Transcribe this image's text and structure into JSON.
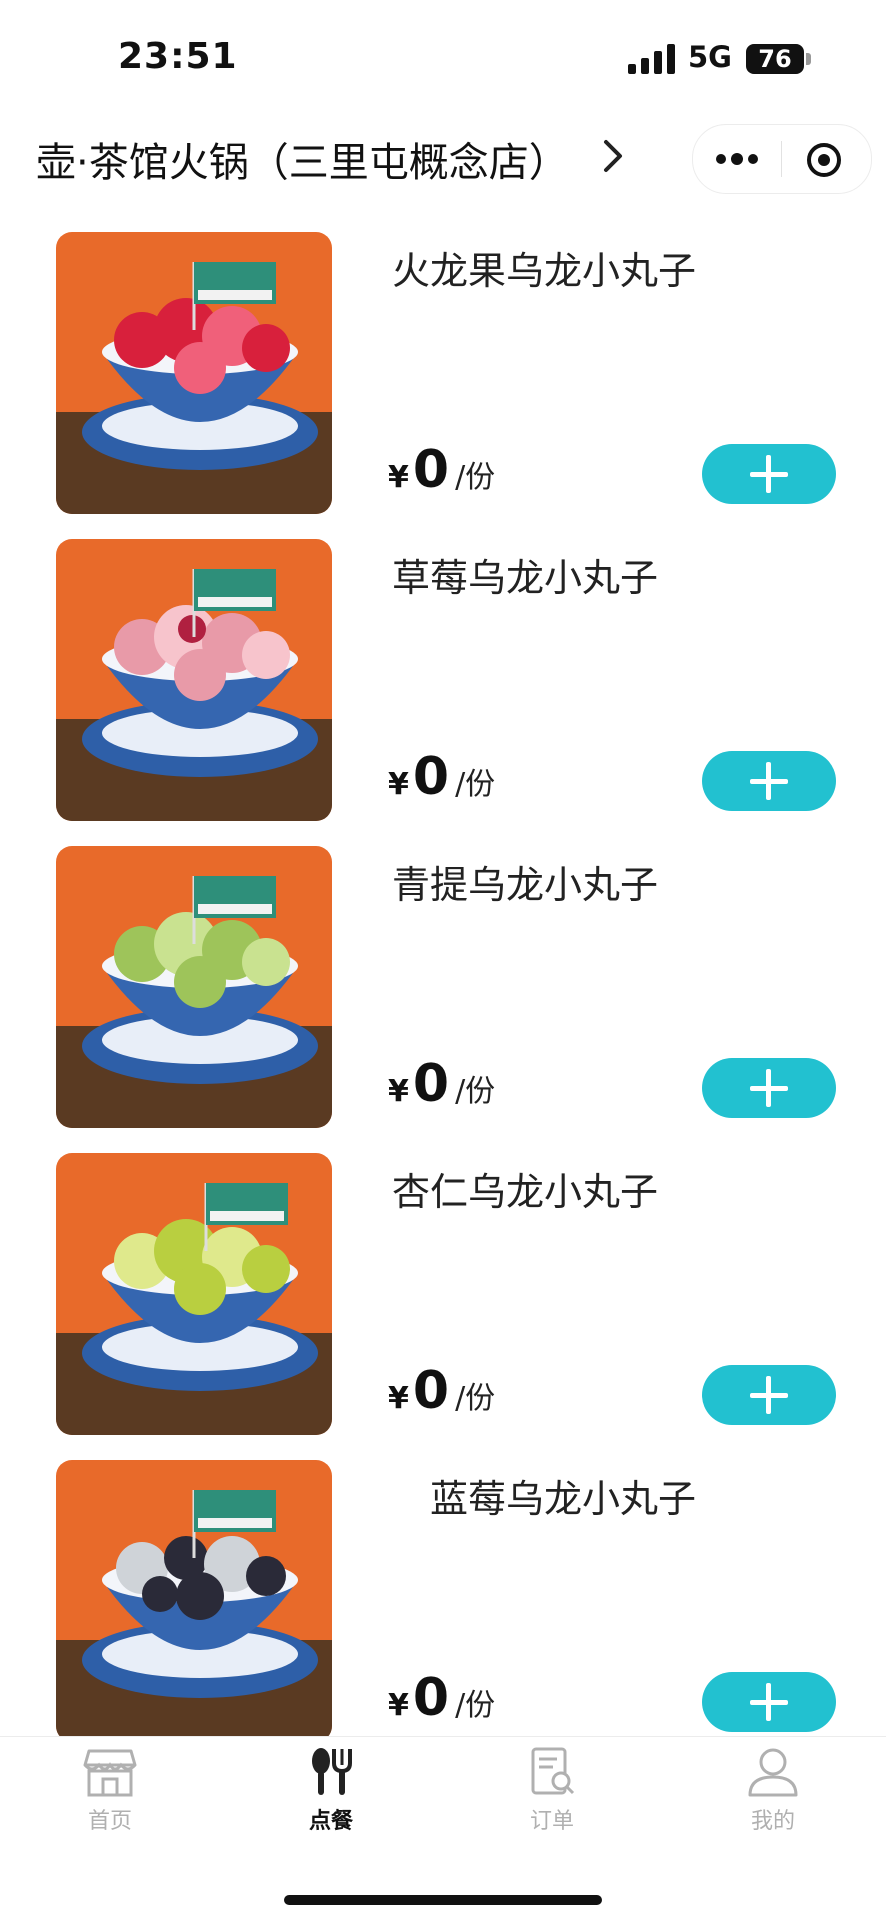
{
  "status_bar": {
    "time": "23:51",
    "network": "5G",
    "battery": "76"
  },
  "nav": {
    "store_title": "壶·茶馆火锅（三里屯概念店）"
  },
  "currency_symbol": "¥",
  "unit_label": "/份",
  "items": [
    {
      "name": "火龙果乌龙小丸子",
      "price": "0",
      "ball_color": "#d8203c",
      "ball_shade": "#f0607a"
    },
    {
      "name": "草莓乌龙小丸子",
      "price": "0",
      "ball_color": "#e89aa8",
      "ball_shade": "#f7c4cc"
    },
    {
      "name": "青提乌龙小丸子",
      "price": "0",
      "ball_color": "#9ec45a",
      "ball_shade": "#c9e290"
    },
    {
      "name": "杏仁乌龙小丸子",
      "price": "0",
      "ball_color": "#b9cf40",
      "ball_shade": "#dfe98c"
    },
    {
      "name": "蓝莓乌龙小丸子",
      "price": "0",
      "ball_color": "#2a2a38",
      "ball_shade": "#cfd3d8"
    }
  ],
  "tabs": [
    {
      "label": "首页",
      "icon": "storefront-icon",
      "active": false
    },
    {
      "label": "点餐",
      "icon": "utensils-icon",
      "active": true
    },
    {
      "label": "订单",
      "icon": "order-search-icon",
      "active": false
    },
    {
      "label": "我的",
      "icon": "person-icon",
      "active": false
    }
  ],
  "colors": {
    "accent": "#22c1d0",
    "tab_inactive": "#b0b0b0",
    "photo_background": "#e86a2a"
  }
}
